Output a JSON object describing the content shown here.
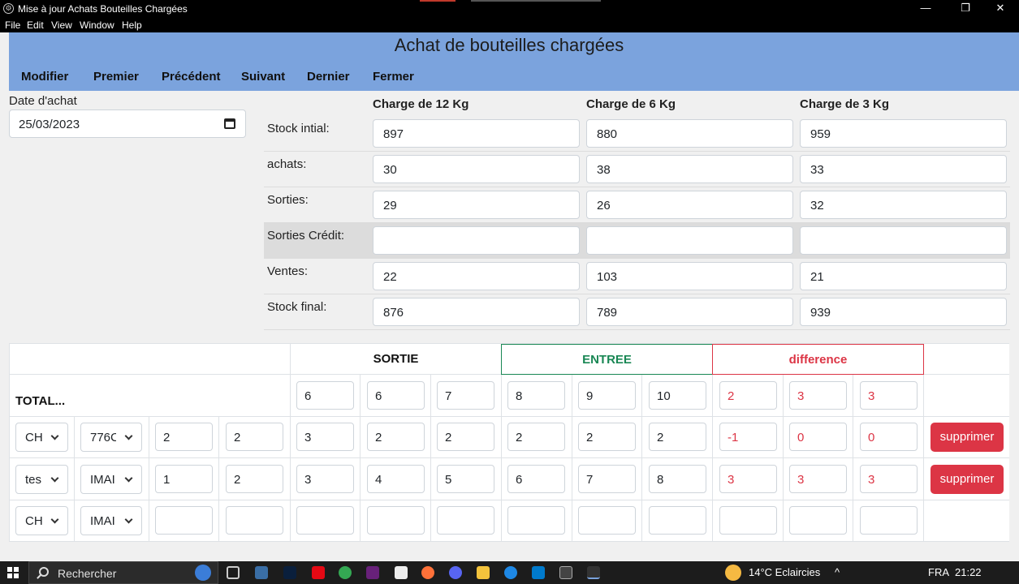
{
  "window": {
    "title": "Mise à jour Achats Bouteilles Chargées",
    "app_icon": "gear-icon",
    "minimize": "—",
    "maximize": "❐",
    "close": "✕"
  },
  "menu": [
    "File",
    "Edit",
    "View",
    "Window",
    "Help"
  ],
  "header": {
    "title": "Achat de bouteilles chargées",
    "nav": [
      "Modifier",
      "Premier",
      "Précédent",
      "Suivant",
      "Dernier",
      "Fermer"
    ]
  },
  "date": {
    "label": "Date d'achat",
    "value": "25/03/2023"
  },
  "stock": {
    "columns": [
      "Charge de 12 Kg",
      "Charge de 6 Kg",
      "Charge de 3 Kg"
    ],
    "rows": [
      {
        "label": "Stock intial:",
        "values": [
          "897",
          "880",
          "959"
        ]
      },
      {
        "label": "achats:",
        "values": [
          "30",
          "38",
          "33"
        ]
      },
      {
        "label": "Sorties:",
        "values": [
          "29",
          "26",
          "32"
        ]
      },
      {
        "label": "Sorties Crédit:",
        "values": [
          "",
          "",
          ""
        ]
      },
      {
        "label": "Ventes:",
        "values": [
          "22",
          "103",
          "21"
        ]
      },
      {
        "label": "Stock final:",
        "values": [
          "876",
          "789",
          "939"
        ]
      }
    ]
  },
  "table": {
    "headers": {
      "sortie": "SORTIE",
      "entree": "ENTREE",
      "difference": "difference"
    },
    "total": {
      "label": "TOTAL...",
      "sortie": [
        "6",
        "6",
        "7"
      ],
      "entree": [
        "8",
        "9",
        "10"
      ],
      "difference": [
        "2",
        "3",
        "3"
      ]
    },
    "rows": [
      {
        "select1": "CH",
        "select2": "776C",
        "a": "2",
        "b": "2",
        "sortie": [
          "3",
          "2",
          "2"
        ],
        "entree": [
          "2",
          "2",
          "2"
        ],
        "difference": [
          "-1",
          "0",
          "0"
        ],
        "action": "supprimer"
      },
      {
        "select1": "tes",
        "select2": "IMAI",
        "a": "1",
        "b": "2",
        "sortie": [
          "3",
          "4",
          "5"
        ],
        "entree": [
          "6",
          "7",
          "8"
        ],
        "difference": [
          "3",
          "3",
          "3"
        ],
        "action": "supprimer"
      },
      {
        "select1": "CH",
        "select2": "IMAI",
        "a": "",
        "b": "",
        "sortie": [
          "",
          "",
          ""
        ],
        "entree": [
          "",
          "",
          ""
        ],
        "difference": [
          "",
          "",
          ""
        ],
        "action": ""
      }
    ]
  },
  "taskbar": {
    "search_placeholder": "Rechercher",
    "weather": "14°C  Eclaircies",
    "language": "FRA",
    "time": "21:22"
  },
  "colors": {
    "header_bg": "#7ba3dd",
    "entree": "#198754",
    "difference": "#dc3545",
    "delete_button": "#dc3545"
  }
}
